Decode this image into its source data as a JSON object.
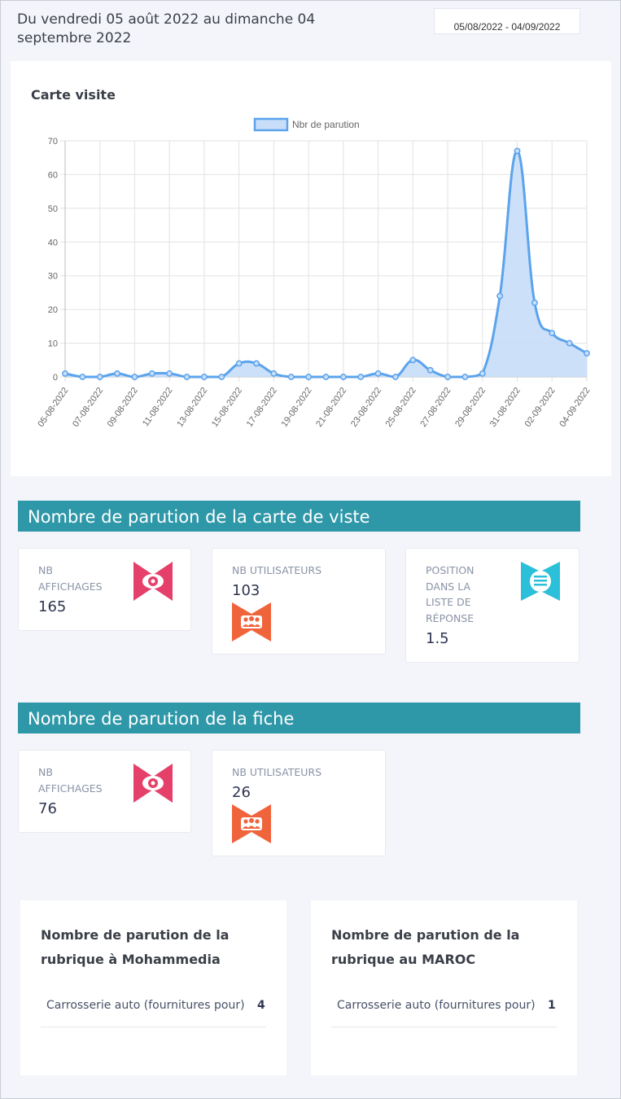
{
  "header": {
    "period_text": "Du vendredi 05 août 2022 au dimanche 04 septembre 2022",
    "date_range": "05/08/2022 - 04/09/2022"
  },
  "chart_card": {
    "title": "Carte visite"
  },
  "chart_data": {
    "type": "area",
    "series": [
      {
        "name": "Nbr de parution",
        "color": "#5ba3ec",
        "fill": "#c7ddf8",
        "values": [
          1,
          0,
          0,
          1,
          0,
          1,
          1,
          0,
          0,
          0,
          4,
          4,
          1,
          0,
          0,
          0,
          0,
          0,
          1,
          0,
          5,
          2,
          0,
          0,
          1,
          24,
          67,
          22,
          13,
          10,
          7
        ]
      }
    ],
    "x": [
      "05-08-2022",
      "06-08-2022",
      "07-08-2022",
      "08-08-2022",
      "09-08-2022",
      "10-08-2022",
      "11-08-2022",
      "12-08-2022",
      "13-08-2022",
      "14-08-2022",
      "15-08-2022",
      "16-08-2022",
      "17-08-2022",
      "18-08-2022",
      "19-08-2022",
      "20-08-2022",
      "21-08-2022",
      "22-08-2022",
      "23-08-2022",
      "24-08-2022",
      "25-08-2022",
      "26-08-2022",
      "27-08-2022",
      "28-08-2022",
      "29-08-2022",
      "30-08-2022",
      "31-08-2022",
      "01-09-2022",
      "02-09-2022",
      "03-09-2022",
      "04-09-2022"
    ],
    "xtick_labels": [
      "05-08-2022",
      "07-08-2022",
      "09-08-2022",
      "11-08-2022",
      "13-08-2022",
      "15-08-2022",
      "17-08-2022",
      "19-08-2022",
      "21-08-2022",
      "23-08-2022",
      "25-08-2022",
      "27-08-2022",
      "29-08-2022",
      "31-08-2022",
      "02-09-2022",
      "04-09-2022"
    ],
    "yticks": [
      "0",
      "10",
      "20",
      "30",
      "40",
      "50",
      "60",
      "70"
    ],
    "ylim": [
      0,
      70
    ],
    "grid": true,
    "legend_position": "top"
  },
  "section1": {
    "title": "Nombre de parution de la carte de viste",
    "cards": [
      {
        "label": "NB AFFICHAGES",
        "value": "165",
        "icon": "eye-icon",
        "color": "#e5406a"
      },
      {
        "label": "NB UTILISATEURS",
        "value": "103",
        "icon": "users-icon",
        "color": "#f0643c"
      },
      {
        "label": "POSITION DANS LA LISTE DE RÉPONSE",
        "value": "1.5",
        "icon": "list-icon",
        "color": "#2bbfd9"
      }
    ]
  },
  "section2": {
    "title": "Nombre de parution de la fiche",
    "cards": [
      {
        "label": "NB AFFICHAGES",
        "value": "76",
        "icon": "eye-icon",
        "color": "#e5406a"
      },
      {
        "label": "NB UTILISATEURS",
        "value": "26",
        "icon": "users-icon",
        "color": "#f0643c"
      }
    ]
  },
  "rubriques": [
    {
      "title": "Nombre de parution de la rubrique à Mohammedia",
      "row_name": "Carrosserie auto (fournitures pour)",
      "row_value": "4("
    },
    {
      "title": "Nombre de parution de la rubrique au MAROC",
      "row_name": "Carrosserie auto (fournitures pour)",
      "row_value": "1:"
    }
  ]
}
